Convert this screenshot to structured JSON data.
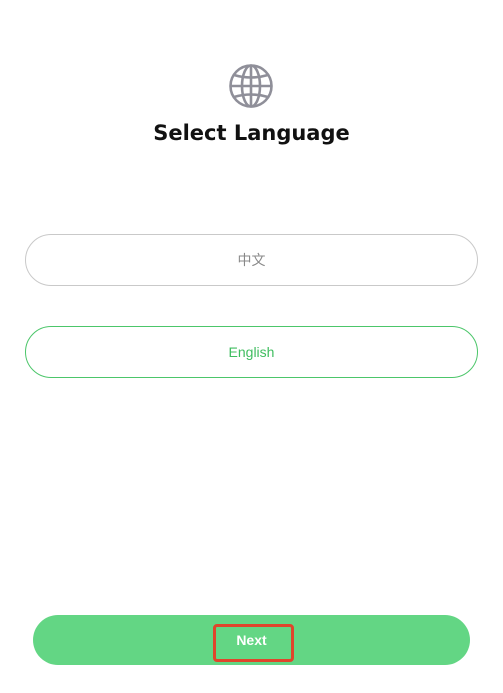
{
  "header": {
    "icon": "globe-icon",
    "title": "Select Language"
  },
  "languages": [
    {
      "label": "中文",
      "selected": false
    },
    {
      "label": "English",
      "selected": true
    }
  ],
  "footer": {
    "next_label": "Next"
  },
  "colors": {
    "accent": "#63d684",
    "selected_border": "#4cc66a",
    "selected_text": "#3fbd5f",
    "unselected_border": "#c9c9c9",
    "highlight": "#e0452b"
  }
}
